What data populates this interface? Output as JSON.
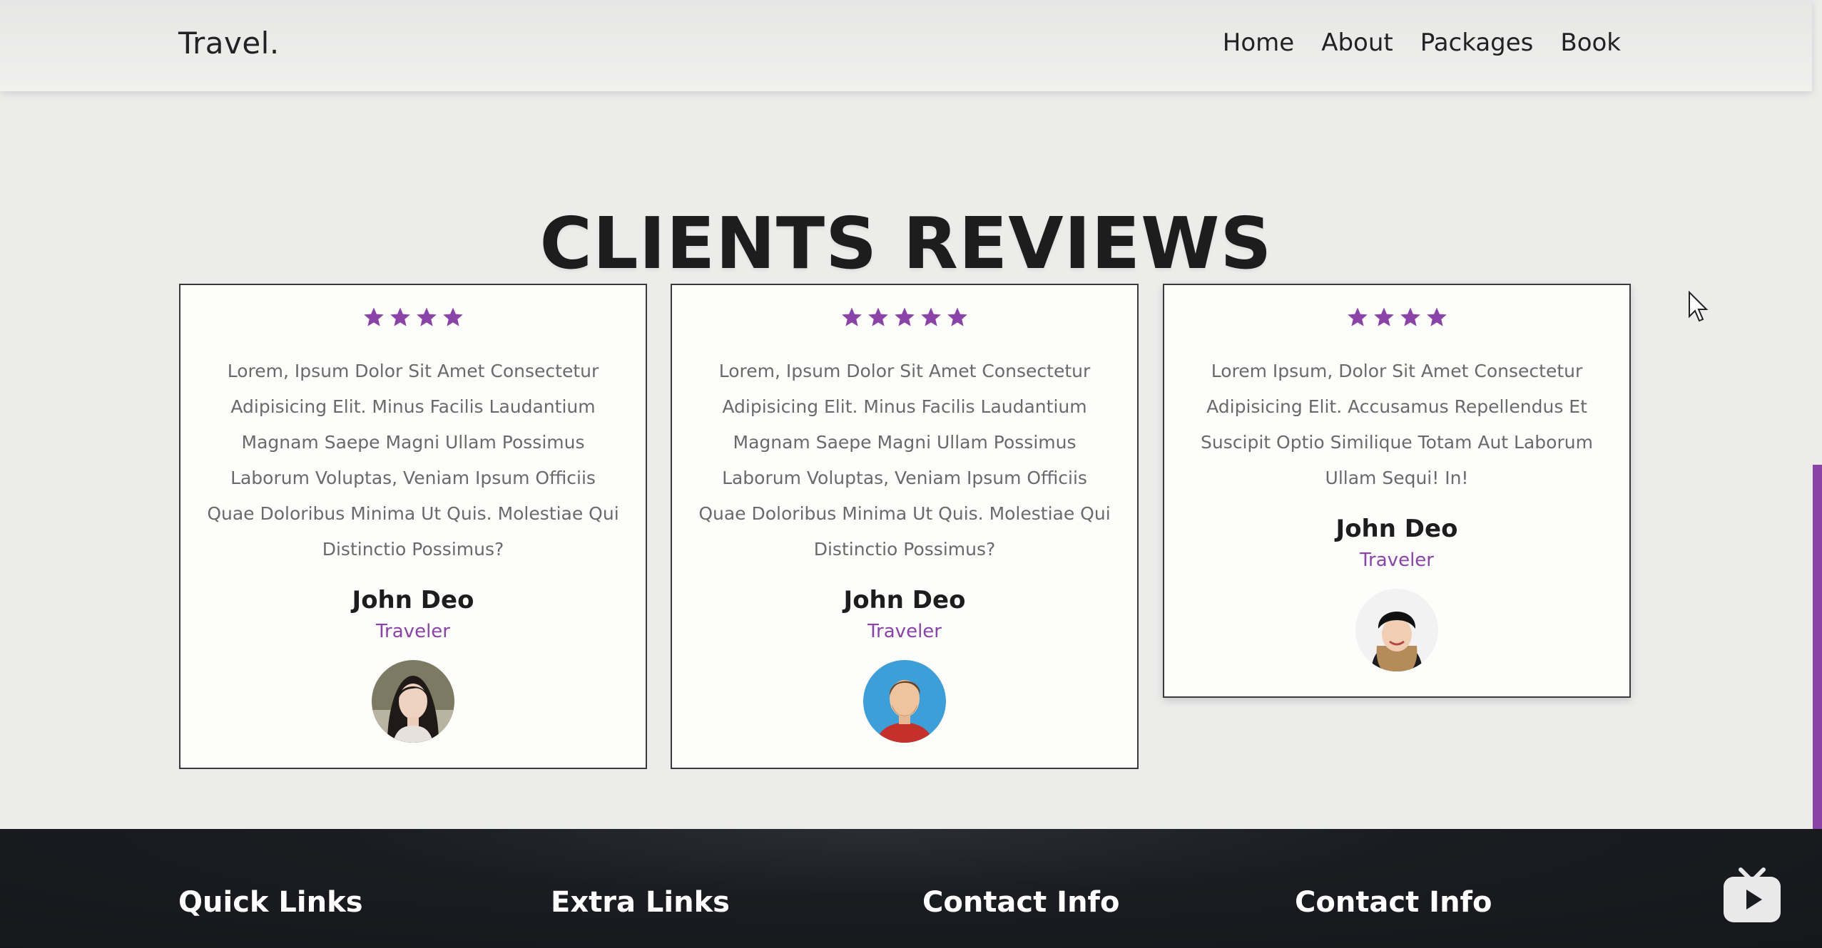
{
  "header": {
    "logo": "Travel.",
    "nav": [
      "Home",
      "About",
      "Packages",
      "Book"
    ]
  },
  "reviews": {
    "title": "CLIENTS REVIEWS",
    "cards": [
      {
        "stars": 4,
        "text": "Lorem, Ipsum Dolor Sit Amet Consectetur Adipisicing Elit. Minus Facilis Laudantium Magnam Saepe Magni Ullam Possimus Laborum Voluptas, Veniam Ipsum Officiis Quae Doloribus Minima Ut Quis. Molestiae Qui Distinctio Possimus?",
        "name": "John Deo",
        "role": "Traveler"
      },
      {
        "stars": 5,
        "text": "Lorem, Ipsum Dolor Sit Amet Consectetur Adipisicing Elit. Minus Facilis Laudantium Magnam Saepe Magni Ullam Possimus Laborum Voluptas, Veniam Ipsum Officiis Quae Doloribus Minima Ut Quis. Molestiae Qui Distinctio Possimus?",
        "name": "John Deo",
        "role": "Traveler"
      },
      {
        "stars": 4,
        "text": "Lorem Ipsum, Dolor Sit Amet Consectetur Adipisicing Elit. Accusamus Repellendus Et Suscipit Optio Similique Totam Aut Laborum Ullam Sequi! In!",
        "name": "John Deo",
        "role": "Traveler"
      }
    ]
  },
  "footer": {
    "headings": [
      "Quick Links",
      "Extra Links",
      "Contact Info",
      "Contact Info"
    ]
  },
  "colors": {
    "accent": "#8a44a8",
    "footer_bg": "#17191d"
  },
  "icons": {
    "star": "star-icon",
    "cursor": "cursor-icon",
    "tv": "tv-play-icon"
  }
}
